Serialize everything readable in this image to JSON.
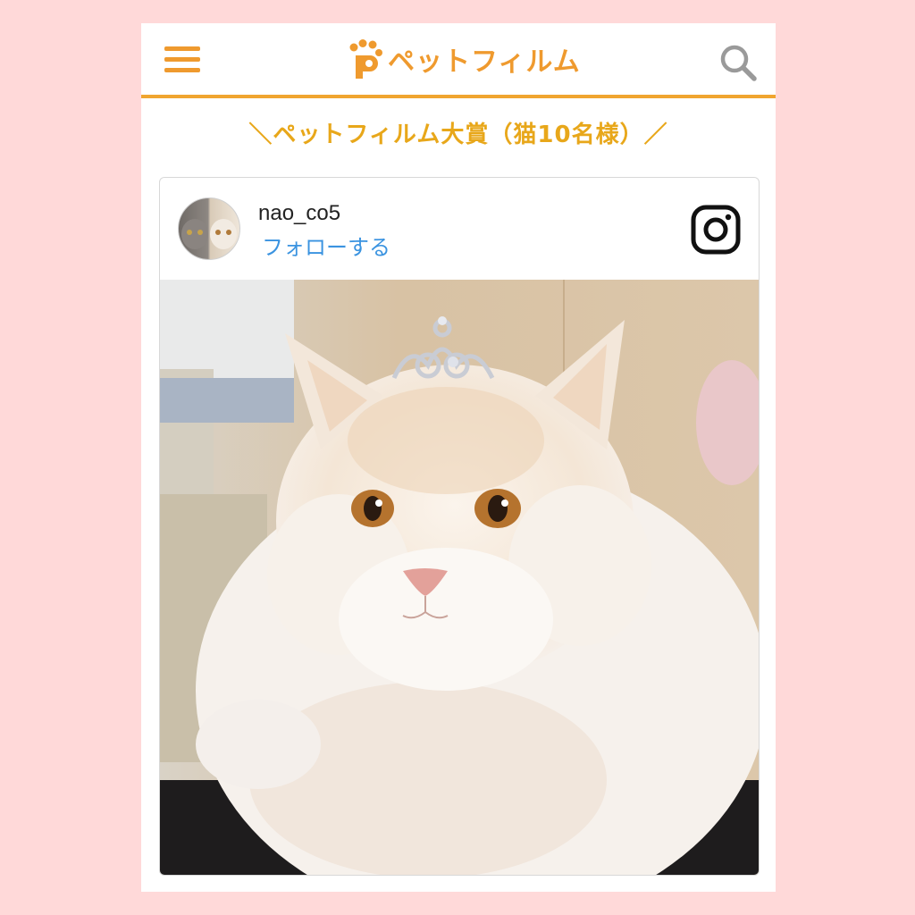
{
  "header": {
    "menu_icon": "hamburger-menu-icon",
    "logo_text": "ペットフィルム",
    "search_icon": "search-icon",
    "accent_color": "#f0a530"
  },
  "banner": {
    "text": "＼ペットフィルム大賞（猫10名様）／"
  },
  "post": {
    "username": "nao_co5",
    "follow_label": "フォローする",
    "platform_icon": "instagram-icon",
    "link_color": "#3a93e0"
  },
  "page": {
    "background_color": "#ffd9d9"
  }
}
